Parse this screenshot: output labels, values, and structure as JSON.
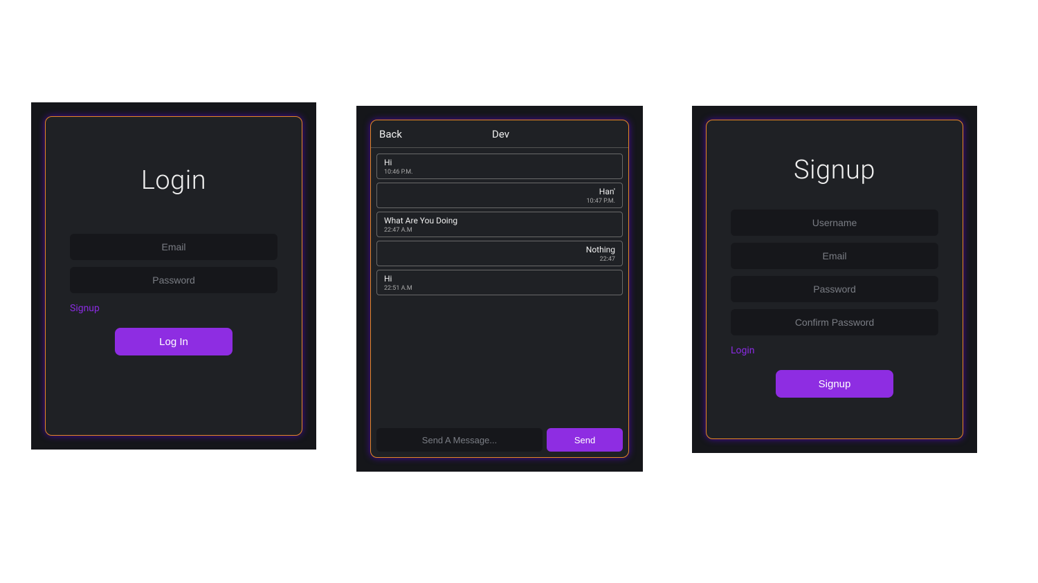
{
  "login": {
    "heading": "Login",
    "email_placeholder": "Email",
    "password_placeholder": "Password",
    "alt_link": "Signup",
    "button": "Log In"
  },
  "signup": {
    "heading": "Signup",
    "username_placeholder": "Username",
    "email_placeholder": "Email",
    "password_placeholder": "Password",
    "confirm_placeholder": "Confirm Password",
    "alt_link": "Login",
    "button": "Signup"
  },
  "chat": {
    "back": "Back",
    "title": "Dev",
    "send": "Send",
    "input_placeholder": "Send A Message...",
    "messages": [
      {
        "text": "Hi",
        "time": "10:46 P.M.",
        "side": "left"
      },
      {
        "text": "Han'",
        "time": "10:47 P.M.",
        "side": "right"
      },
      {
        "text": "What Are You Doing",
        "time": "22:47 A.M",
        "side": "left"
      },
      {
        "text": "Nothing",
        "time": "22:47",
        "side": "right"
      },
      {
        "text": "Hi",
        "time": "22:51 A.M",
        "side": "left"
      }
    ]
  }
}
